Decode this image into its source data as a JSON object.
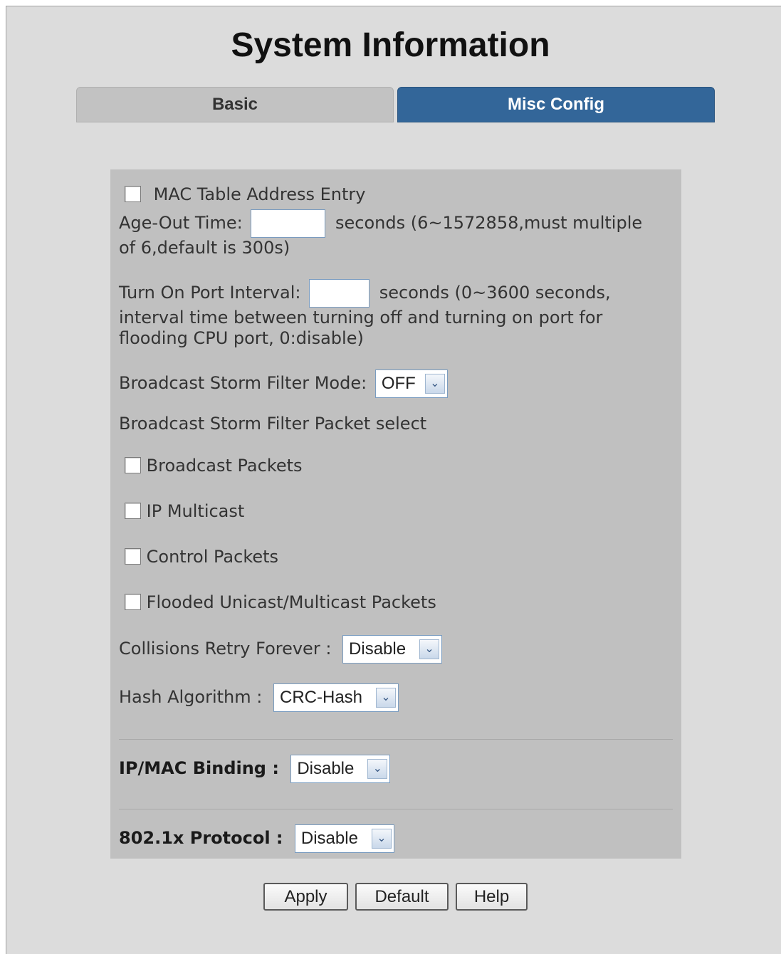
{
  "page": {
    "title": "System Information"
  },
  "tabs": [
    {
      "label": "Basic",
      "active": false
    },
    {
      "label": "Misc Config",
      "active": true
    }
  ],
  "form": {
    "mac_table_label": "MAC Table Address Entry",
    "age_out_label": "Age-Out Time:",
    "age_out_value": "",
    "age_out_hint": "seconds (6~1572858,must multiple of 6,default is 300s)",
    "turn_on_label": "Turn On Port Interval:",
    "turn_on_value": "",
    "turn_on_hint": "seconds (0~3600 seconds, interval time between turning off and turning on port for flooding CPU port, 0:disable)",
    "storm_mode_label": "Broadcast Storm Filter Mode:",
    "storm_mode_value": "OFF",
    "storm_packet_label": "Broadcast Storm Filter Packet select",
    "packet_options": [
      "Broadcast Packets",
      "IP Multicast",
      "Control Packets",
      "Flooded Unicast/Multicast Packets"
    ],
    "collisions_label": "Collisions Retry Forever :",
    "collisions_value": "Disable",
    "hash_label": "Hash Algorithm :",
    "hash_value": "CRC-Hash",
    "ipmac_label": "IP/MAC Binding :",
    "ipmac_value": "Disable",
    "dot1x_label": "802.1x Protocol :",
    "dot1x_value": "Disable"
  },
  "buttons": {
    "apply": "Apply",
    "default": "Default",
    "help": "Help"
  },
  "colors": {
    "active_tab": "#336699",
    "inactive_tab": "#c2c2c2",
    "panel": "#c0c0c0",
    "background": "#dcdcdc"
  }
}
